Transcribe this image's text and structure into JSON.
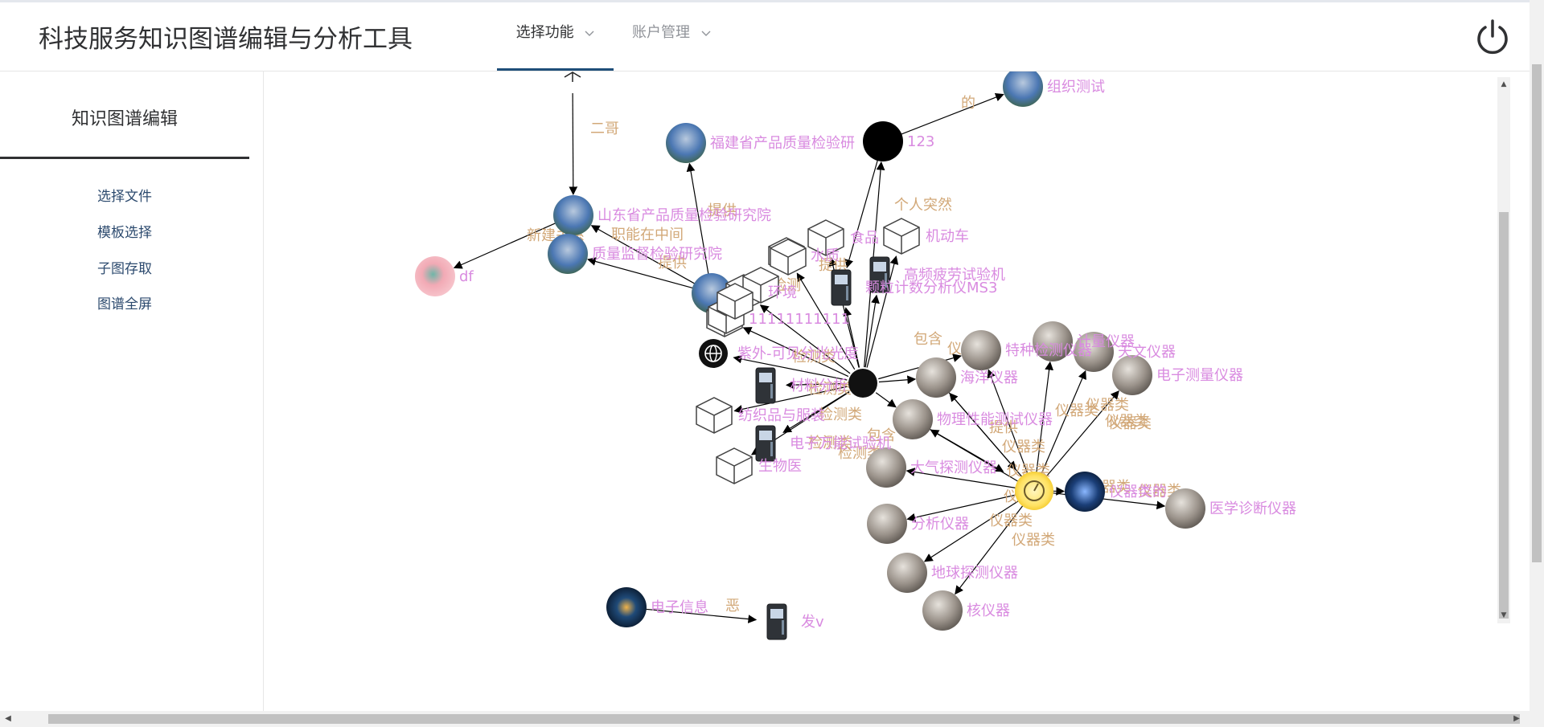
{
  "app": {
    "title": "科技服务知识图谱编辑与分析工具"
  },
  "nav": {
    "menus": [
      {
        "label": "选择功能",
        "active": true
      },
      {
        "label": "账户管理",
        "active": false
      }
    ]
  },
  "header": {
    "power_icon": "power-icon"
  },
  "sidebar": {
    "heading": "知识图谱编辑",
    "items": [
      {
        "label": "选择文件"
      },
      {
        "label": "模板选择"
      },
      {
        "label": "子图存取"
      },
      {
        "label": "图谱全屏"
      }
    ]
  },
  "graph": {
    "colors": {
      "node_label": "#d98be0",
      "edge_label": "#d2a878",
      "edge": "#000000"
    },
    "nodes": [
      {
        "id": "n_top",
        "label": "",
        "icon": "arrow-head-icon"
      },
      {
        "id": "n_org",
        "label": "组织测试",
        "icon": "building-photo"
      },
      {
        "id": "n_fj",
        "label": "福建省产品质量检验研",
        "icon": "building-photo"
      },
      {
        "id": "n_123",
        "label": "123",
        "icon": "black-circle"
      },
      {
        "id": "n_sd",
        "label": "山东省产品质量检验研究院",
        "icon": "building-photo"
      },
      {
        "id": "n_df",
        "label": "df",
        "icon": "pink-photo"
      },
      {
        "id": "n_zj",
        "label": "质量监督检验研究院",
        "icon": "building-photo"
      },
      {
        "id": "n_hub1",
        "label": "",
        "icon": "building-photo"
      },
      {
        "id": "n_food",
        "label": "食品",
        "icon": "cube-icon"
      },
      {
        "id": "n_car",
        "label": "机动车",
        "icon": "cube-icon"
      },
      {
        "id": "n_water",
        "label": "水质",
        "icon": "cube-icon"
      },
      {
        "id": "n_hf",
        "label": "高频疲劳试验机",
        "icon": "machine-icon"
      },
      {
        "id": "n_ms3",
        "label": "颗粒计数分析仪MS3",
        "icon": "machine-icon"
      },
      {
        "id": "n_env",
        "label": "环境",
        "icon": "cube-icon"
      },
      {
        "id": "n_111",
        "label": "11111111111",
        "icon": "cube-icon"
      },
      {
        "id": "n_globe",
        "label": "紫外-可见分光光度",
        "icon": "globe-icon"
      },
      {
        "id": "n_mat",
        "label": "材料分析",
        "icon": "machine-icon"
      },
      {
        "id": "n_elec",
        "label": "电子万能试验机",
        "icon": "machine-icon"
      },
      {
        "id": "n_text",
        "label": "纺织品与服装",
        "icon": "cube-icon"
      },
      {
        "id": "n_bio",
        "label": "生物医",
        "icon": "cube-icon"
      },
      {
        "id": "n_special",
        "label": "特种检测仪器",
        "icon": "gauge-photo"
      },
      {
        "id": "n_count",
        "label": "计量仪器",
        "icon": "gauge-photo"
      },
      {
        "id": "n_astro",
        "label": "天文仪器",
        "icon": "gauge-photo"
      },
      {
        "id": "n_etest",
        "label": "电子测量仪器",
        "icon": "gauge-photo"
      },
      {
        "id": "n_ocean",
        "label": "海洋仪器",
        "icon": "gauge-photo"
      },
      {
        "id": "n_phys",
        "label": "物理性能测试仪器",
        "icon": "gauge-photo"
      },
      {
        "id": "n_atmo",
        "label": "大气探测仪器",
        "icon": "gauge-photo"
      },
      {
        "id": "n_center",
        "label": "",
        "icon": "yellow-gauge-icon"
      },
      {
        "id": "n_blue",
        "label": "仪器类的",
        "icon": "blue-photo"
      },
      {
        "id": "n_med",
        "label": "医学诊断仪器",
        "icon": "gauge-photo"
      },
      {
        "id": "n_anal",
        "label": "分析仪器",
        "icon": "gauge-photo"
      },
      {
        "id": "n_earth",
        "label": "地球探测仪器",
        "icon": "gauge-photo"
      },
      {
        "id": "n_nuc",
        "label": "核仪器",
        "icon": "gauge-photo"
      },
      {
        "id": "n_einfo",
        "label": "电子信息",
        "icon": "dark-photo"
      },
      {
        "id": "n_fav",
        "label": "发v",
        "icon": "machine-icon"
      }
    ],
    "edge_labels": [
      "二哥",
      "的",
      "提供",
      "新建关系",
      "职能在中间",
      "提供",
      "个人突然",
      "检测",
      "提供",
      "包含",
      "包含",
      "检测类",
      "检测类",
      "检测类",
      "检测类",
      "检测类",
      "仪器类",
      "仪器类",
      "仪器类",
      "仪器类",
      "仪器类",
      "仪器类",
      "仪器类",
      "仪器类",
      "仪器类",
      "仪器类",
      "仪器类",
      "仪器类",
      "提供",
      "恶"
    ]
  }
}
